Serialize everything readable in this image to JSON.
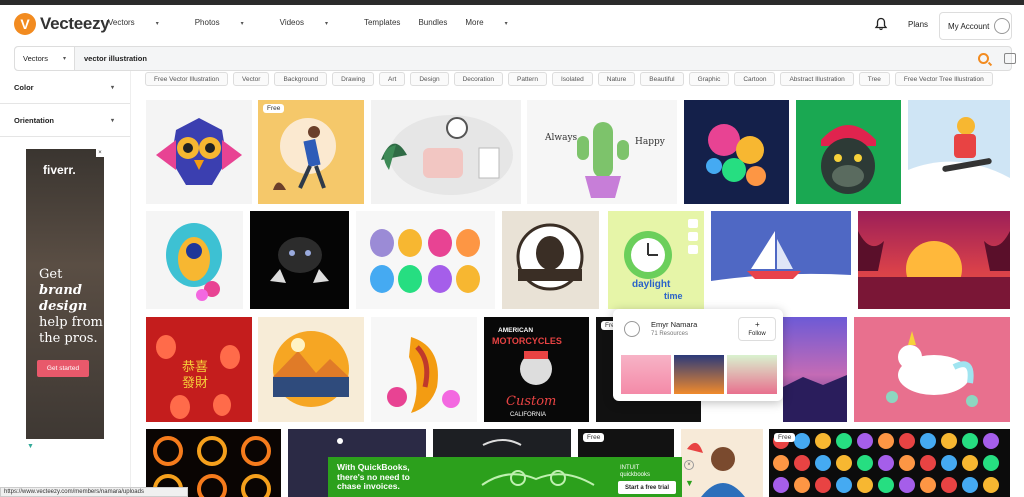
{
  "brand": {
    "name": "Vecteezy",
    "accent": "#f28b20"
  },
  "nav": {
    "items": [
      {
        "label": "Vectors",
        "dropdown": true
      },
      {
        "label": "Photos",
        "dropdown": true
      },
      {
        "label": "Videos",
        "dropdown": true
      },
      {
        "label": "Templates",
        "dropdown": false
      },
      {
        "label": "Bundles",
        "dropdown": false
      },
      {
        "label": "More",
        "dropdown": true
      }
    ],
    "plans": "Plans",
    "account": "My Account"
  },
  "search": {
    "type": "Vectors",
    "query": "vector illustration"
  },
  "sidebar": {
    "filters": [
      "Color",
      "Orientation"
    ]
  },
  "side_ad": {
    "logo": "fiverr.",
    "line1": "Get",
    "line2": "brand",
    "line3": "design",
    "line4": "help from",
    "line5": "the pros.",
    "button": "Get started"
  },
  "tags": [
    "Free Vector Illustration",
    "Vector",
    "Background",
    "Drawing",
    "Art",
    "Design",
    "Decoration",
    "Pattern",
    "Isolated",
    "Nature",
    "Beautiful",
    "Graphic",
    "Cartoon",
    "Abstract Illustration",
    "Tree",
    "Free Vector Tree Illustration"
  ],
  "grid": {
    "badges": [
      "Free",
      "Free",
      "Free",
      "Free"
    ],
    "hover_card_text1": "daylight",
    "hover_card_text2": "time"
  },
  "popup": {
    "name": "Emyr Namara",
    "resources": "71 Resources",
    "follow": "Follow"
  },
  "bottom_ad": {
    "text1": "With QuickBooks,",
    "text2": "there's no need to",
    "text3": "chase invoices.",
    "logo1": "INTUIT",
    "logo2": "quickbooks",
    "button": "Start a free trial"
  },
  "status_url": "https://www.vecteezy.com/members/namara/uploads"
}
